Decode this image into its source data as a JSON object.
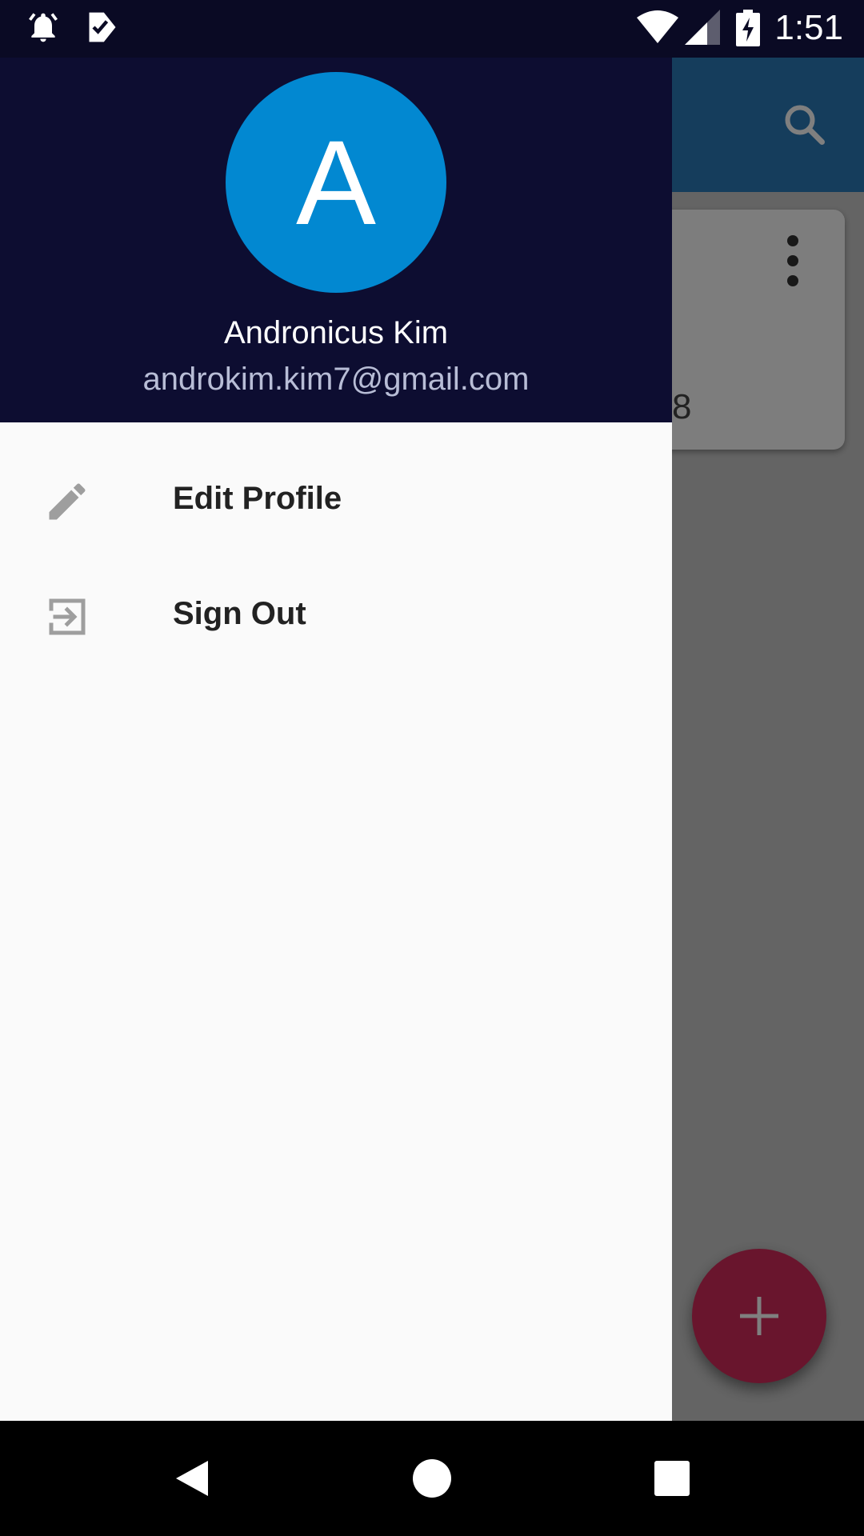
{
  "status_bar": {
    "time": "1:51",
    "icons": [
      "alarm-icon",
      "task-check-icon",
      "wifi-icon",
      "signal-icon",
      "battery-charging-icon"
    ]
  },
  "drawer": {
    "header": {
      "avatar_letter": "A",
      "avatar_color": "#0288d1",
      "name": "Andronicus Kim",
      "email": "androkim.kim7@gmail.com"
    },
    "items": [
      {
        "label": "Edit Profile",
        "icon": "pencil-icon"
      },
      {
        "label": "Sign Out",
        "icon": "exit-icon"
      }
    ]
  },
  "background_app": {
    "toolbar_icon": "search-icon",
    "card_text": "8",
    "fab_icon": "plus-icon",
    "fab_color": "#d22b5a"
  },
  "nav_bar": {
    "buttons": [
      "back-icon",
      "home-icon",
      "recents-icon"
    ]
  }
}
